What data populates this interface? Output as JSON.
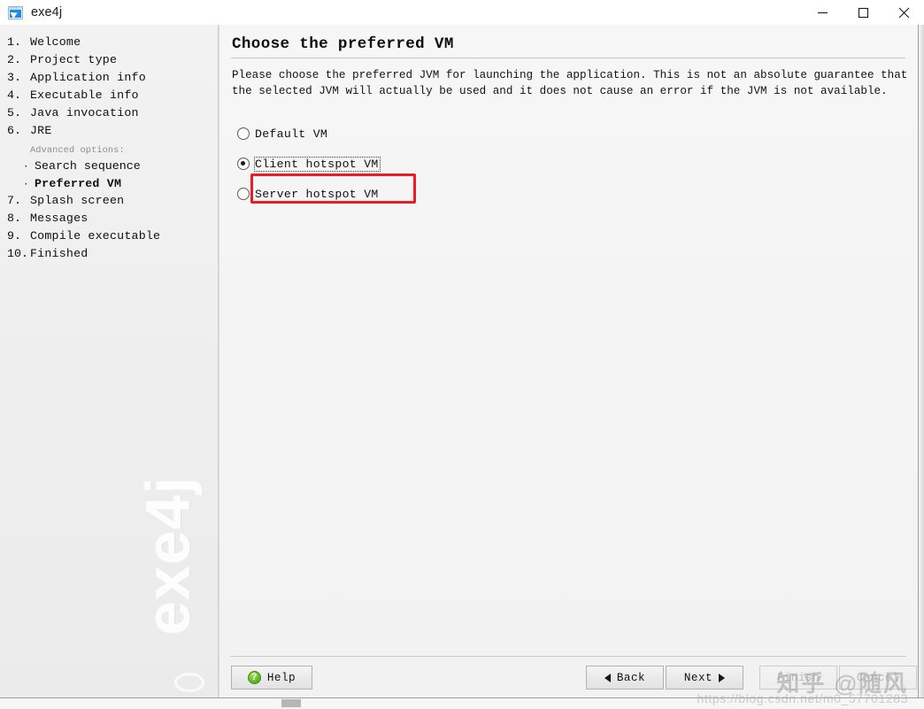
{
  "window": {
    "title": "exe4j",
    "app_icon": "exe4j-app-icon",
    "controls": {
      "minimize": "minimize-icon",
      "maximize": "maximize-icon",
      "close": "close-icon"
    }
  },
  "sidebar": {
    "watermark": "exe4j",
    "steps": [
      {
        "num": "1.",
        "label": "Welcome",
        "current": false
      },
      {
        "num": "2.",
        "label": "Project type",
        "current": false
      },
      {
        "num": "3.",
        "label": "Application info",
        "current": false
      },
      {
        "num": "4.",
        "label": "Executable info",
        "current": false
      },
      {
        "num": "5.",
        "label": "Java invocation",
        "current": false
      },
      {
        "num": "6.",
        "label": "JRE",
        "current": false
      }
    ],
    "advanced_heading": "Advanced options:",
    "advanced_items": [
      {
        "bullet": "·",
        "label": "Search sequence",
        "current": false
      },
      {
        "bullet": "·",
        "label": "Preferred VM",
        "current": true
      }
    ],
    "steps_after": [
      {
        "num": "7.",
        "label": "Splash screen",
        "current": false
      },
      {
        "num": "8.",
        "label": "Messages",
        "current": false
      },
      {
        "num": "9.",
        "label": "Compile executable",
        "current": false
      },
      {
        "num": "10.",
        "label": "Finished",
        "current": false
      }
    ]
  },
  "main": {
    "title": "Choose the preferred VM",
    "description": "Please choose the preferred JVM for launching the application. This is not an absolute guarantee that the selected JVM will actually be used and it does not cause an error if the JVM is not available.",
    "options": [
      {
        "label": "Default VM",
        "selected": false,
        "focused": false
      },
      {
        "label": "Client hotspot VM",
        "selected": true,
        "focused": true
      },
      {
        "label": "Server hotspot VM",
        "selected": false,
        "focused": false
      }
    ],
    "annotation": {
      "color": "#ed1c24",
      "target": "Client hotspot VM"
    }
  },
  "footer": {
    "help": {
      "label": "Help",
      "icon": "question-mark-icon",
      "icon_color": "#62b828"
    },
    "back": {
      "label": "Back",
      "icon": "triangle-left-icon",
      "disabled": false
    },
    "next": {
      "label": "Next",
      "icon": "triangle-right-icon",
      "disabled": false
    },
    "finish": {
      "label": "Finish",
      "disabled": true
    },
    "cancel": {
      "label": "Cancel",
      "disabled": true
    }
  },
  "watermarks": {
    "cn": "知乎 @随风",
    "url": "https://blog.csdn.net/m0_57701283"
  }
}
